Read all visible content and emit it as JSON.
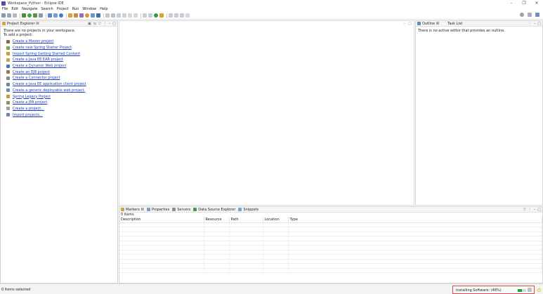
{
  "window": {
    "title": "Workspace_Python - Eclipse IDE",
    "controls": [
      "–",
      "❐",
      "✕"
    ]
  },
  "menu": [
    "File",
    "Edit",
    "Navigate",
    "Search",
    "Project",
    "Run",
    "Window",
    "Help"
  ],
  "explorer": {
    "tab_label": "Project Explorer ☒",
    "no_projects": "There are no projects in your workspace.",
    "to_add": "To add a project:",
    "links": [
      {
        "label": "Create a Maven project",
        "icon": "maven-icon",
        "color": "#8b6a3a"
      },
      {
        "label": "Create new Spring Starter Project",
        "icon": "spring-icon",
        "color": "#6fae3e"
      },
      {
        "label": "Import Spring Getting Started Content",
        "icon": "spring-import-icon",
        "color": "#d39a2b"
      },
      {
        "label": "Create a Java EE EAR project",
        "icon": "ear-icon",
        "color": "#c7a24a"
      },
      {
        "label": "Create a Dynamic Web project",
        "icon": "web-icon",
        "color": "#4d78b8"
      },
      {
        "label": "Create an EJB project",
        "icon": "ejb-icon",
        "color": "#9a7a4a"
      },
      {
        "label": "Create a Connector project",
        "icon": "connector-icon",
        "color": "#8a8a8a"
      },
      {
        "label": "Create a Java EE application client project",
        "icon": "client-icon",
        "color": "#6c86b0"
      },
      {
        "label": "Create a generic deployable web project.",
        "icon": "generic-web-icon",
        "color": "#6a8fbf"
      },
      {
        "label": "Spring Legacy Project",
        "icon": "spring-legacy-icon",
        "color": "#d39a2b"
      },
      {
        "label": "Create a JPA project",
        "icon": "jpa-icon",
        "color": "#7b9a5a"
      },
      {
        "label": "Create a project...",
        "icon": "project-icon",
        "color": "#a0a0a0"
      },
      {
        "label": "Import projects...",
        "icon": "import-icon",
        "color": "#6f84a8"
      }
    ]
  },
  "outline": {
    "tab_outline": "Outline ☒",
    "tab_tasks": "Task List",
    "message": "There is no active editor that provides an outline."
  },
  "bottom": {
    "tabs": [
      "Markers ☒",
      "Properties",
      "Servers",
      "Data Source Explorer",
      "Snippets"
    ],
    "items_count": "0 items",
    "columns": [
      "Description",
      "Resource",
      "Path",
      "Location",
      "Type"
    ]
  },
  "status": {
    "selection": "0 items selected",
    "progress_label": "Installing Software: (48%)",
    "progress_fraction": 0.48
  },
  "colors": {
    "accent": "#1a3cbd",
    "progress": "#17a831",
    "highlight_border": "#e0484b"
  }
}
